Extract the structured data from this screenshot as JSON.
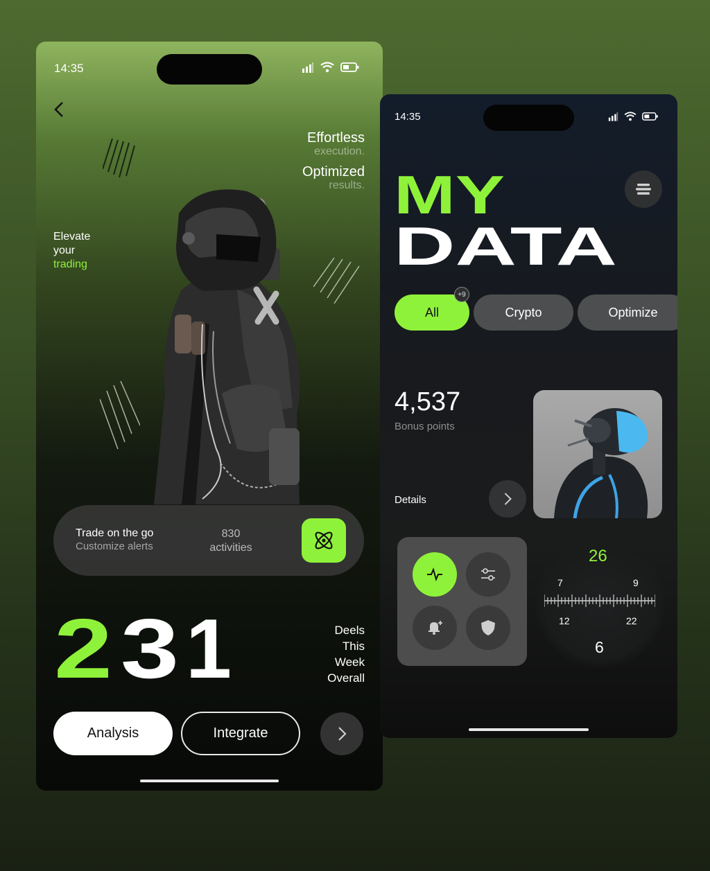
{
  "colors": {
    "accent": "#8ff23a",
    "dark_card": "#333333"
  },
  "left_phone": {
    "status_time": "14:35",
    "tagline": [
      {
        "big": "Effortless",
        "small": "execution."
      },
      {
        "big": "Optimized",
        "small": "results."
      }
    ],
    "elevate": {
      "line1": "Elevate",
      "line2": "your",
      "highlight": "trading"
    },
    "trade_card": {
      "title": "Trade on the go",
      "subtitle": "Customize alerts",
      "activities_count": "830",
      "activities_label": "activities",
      "action_icon": "atom-icon"
    },
    "big_number": {
      "digit1": "2",
      "digit2": "3",
      "digit3": "1"
    },
    "deels": [
      "Deels",
      "This",
      "Week",
      "Overall"
    ],
    "buttons": {
      "analysis": "Analysis",
      "integrate": "Integrate"
    }
  },
  "right_phone": {
    "status_time": "14:35",
    "title": {
      "line1": "MY",
      "line2": "DATA"
    },
    "chips": {
      "all": "All",
      "crypto": "Crypto",
      "optimize": "Optimize",
      "badge": "+9"
    },
    "points": {
      "value": "4,537",
      "label": "Bonus points"
    },
    "details_label": "Details",
    "controls": [
      "activity-icon",
      "sliders-icon",
      "bell-plus-icon",
      "shield-icon"
    ],
    "gauge": {
      "top": "26",
      "left_top": "7",
      "right_top": "9",
      "left_bottom": "12",
      "right_bottom": "22",
      "bottom": "6"
    }
  }
}
